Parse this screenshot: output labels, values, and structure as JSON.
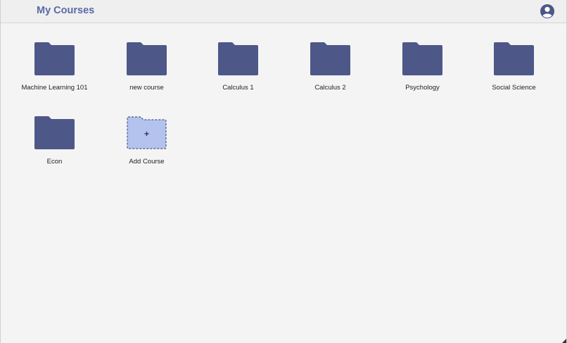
{
  "header": {
    "title": "My Courses",
    "profile_icon": "user-circle-icon"
  },
  "courses": [
    {
      "label": "Machine Learning 101",
      "icon": "folder-icon"
    },
    {
      "label": "new course",
      "icon": "folder-icon"
    },
    {
      "label": "Calculus 1",
      "icon": "folder-icon"
    },
    {
      "label": "Calculus 2",
      "icon": "folder-icon"
    },
    {
      "label": "Psychology",
      "icon": "folder-icon"
    },
    {
      "label": "Social Science",
      "icon": "folder-icon"
    },
    {
      "label": "Econ",
      "icon": "folder-icon"
    }
  ],
  "add_course": {
    "label": "Add Course",
    "icon": "add-folder-icon",
    "symbol": "+"
  },
  "colors": {
    "folder": "#4d5888",
    "folder_add_fill": "#b4c2ee",
    "folder_add_border": "#4d5888",
    "title": "#5a6aa8",
    "background": "#f4f4f4"
  }
}
